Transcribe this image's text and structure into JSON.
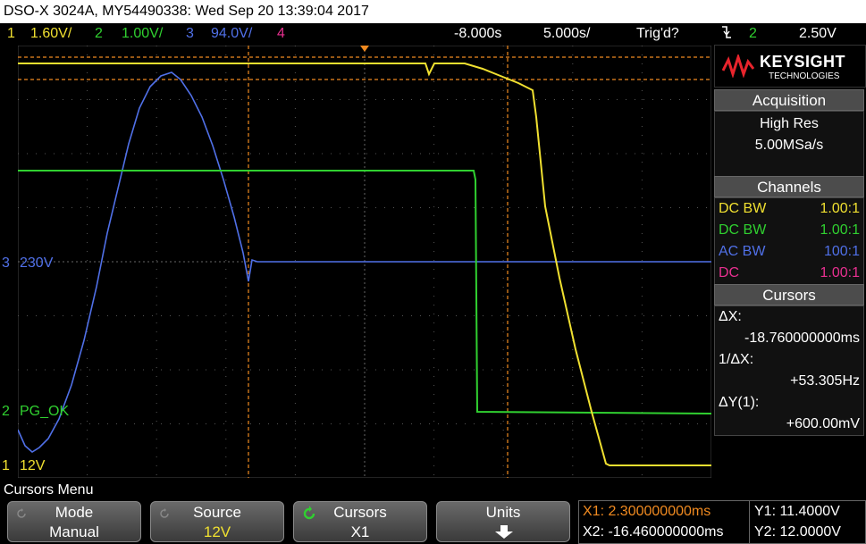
{
  "title": "DSO-X 3024A, MY54490338: Wed Sep 20 13:39:04 2017",
  "channels_bar": {
    "ch1_num": "1",
    "ch1_scale": "1.60V/",
    "ch2_num": "2",
    "ch2_scale": "1.00V/",
    "ch3_num": "3",
    "ch3_scale": "94.0V/",
    "ch4_num": "4",
    "delay": "-8.000s",
    "timebase": "5.000s/",
    "trigger_status": "Trig'd?",
    "trigger_icon": "trigger-fall-icon",
    "trigger_source": "2",
    "trigger_level": "2.50V"
  },
  "colors": {
    "ch1": "#f0e030",
    "ch2": "#30d030",
    "ch3": "#5070e8",
    "ch4": "#e83090",
    "cursor": "#f08a20",
    "panel_header": "#4c4c4c"
  },
  "graticule": {
    "ch3_marker": "3",
    "ch3_label": "230V",
    "ch2_marker": "2",
    "ch2_label": "PG_OK",
    "ch1_marker": "1",
    "ch1_label": "12V"
  },
  "panel": {
    "logo_name": "KEYSIGHT",
    "logo_sub": "TECHNOLOGIES",
    "acquisition_header": "Acquisition",
    "acq_mode": "High Res",
    "acq_rate": "5.00MSa/s",
    "channels_header": "Channels",
    "channel_rows": [
      {
        "coupling": "DC BW",
        "probe": "1.00:1"
      },
      {
        "coupling": "DC BW",
        "probe": "1.00:1"
      },
      {
        "coupling": "AC BW",
        "probe": "100:1"
      },
      {
        "coupling": "DC",
        "probe": "1.00:1"
      }
    ],
    "cursors_header": "Cursors",
    "dx_label": "ΔX:",
    "dx_value": "-18.760000000ms",
    "inv_dx_label": "1/ΔX:",
    "inv_dx_value": "+53.305Hz",
    "dy_label": "ΔY(1):",
    "dy_value": "+600.00mV"
  },
  "menu_title": "Cursors Menu",
  "softkeys": [
    {
      "title": "Mode",
      "value": "Manual"
    },
    {
      "title": "Source",
      "value": "12V"
    },
    {
      "title": "Cursors",
      "value": "X1"
    },
    {
      "title": "Units",
      "value": ""
    }
  ],
  "readout": {
    "x1": "X1: 2.300000000ms",
    "x2": "X2: -16.460000000ms",
    "y1": "Y1: 11.4000V",
    "y2": "Y2: 12.0000V"
  }
}
